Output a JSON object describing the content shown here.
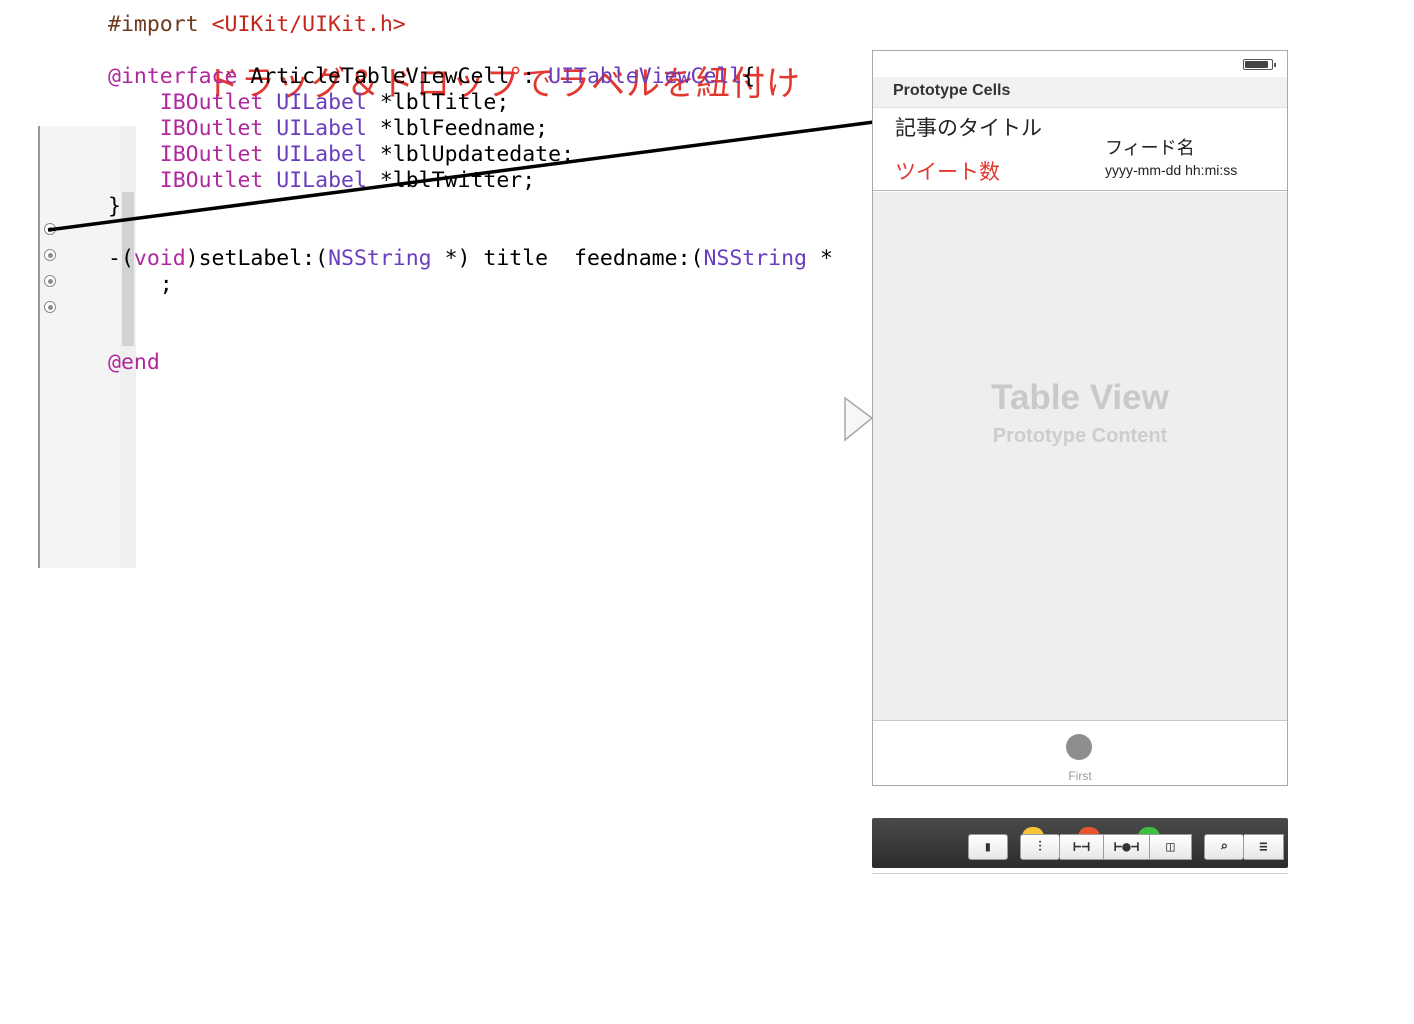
{
  "annotation": {
    "text": "ドラッグ＆ドロップでラベルを紐付け"
  },
  "code": {
    "lines": [
      [
        {
          "t": "#import ",
          "c": "pp"
        },
        {
          "t": "<UIKit/UIKit.h>",
          "c": "str"
        }
      ],
      [],
      [
        {
          "t": "@interface",
          "c": "kw"
        },
        {
          "t": " ArticleTableViewCell : "
        },
        {
          "t": "UITableViewCell",
          "c": "ty"
        },
        {
          "t": "{"
        }
      ],
      [
        {
          "t": "    "
        },
        {
          "t": "IBOutlet",
          "c": "kw"
        },
        {
          "t": " "
        },
        {
          "t": "UILabel",
          "c": "ty"
        },
        {
          "t": " *lblTitle;"
        }
      ],
      [
        {
          "t": "    "
        },
        {
          "t": "IBOutlet",
          "c": "kw"
        },
        {
          "t": " "
        },
        {
          "t": "UILabel",
          "c": "ty"
        },
        {
          "t": " *lblFeedname;"
        }
      ],
      [
        {
          "t": "    "
        },
        {
          "t": "IBOutlet",
          "c": "kw"
        },
        {
          "t": " "
        },
        {
          "t": "UILabel",
          "c": "ty"
        },
        {
          "t": " *lblUpdatedate;"
        }
      ],
      [
        {
          "t": "    "
        },
        {
          "t": "IBOutlet",
          "c": "kw"
        },
        {
          "t": " "
        },
        {
          "t": "UILabel",
          "c": "ty"
        },
        {
          "t": " *lblTwitter;"
        }
      ],
      [
        {
          "t": "}"
        }
      ],
      [],
      [
        {
          "t": "-("
        },
        {
          "t": "void",
          "c": "kw"
        },
        {
          "t": ")setLabel:("
        },
        {
          "t": "NSString",
          "c": "ty"
        },
        {
          "t": " *) title  feedname:("
        },
        {
          "t": "NSString",
          "c": "ty"
        },
        {
          "t": " *"
        }
      ],
      [
        {
          "t": "    ;"
        }
      ],
      [],
      [],
      [
        {
          "t": "@end",
          "c": "kw"
        }
      ]
    ]
  },
  "scene": {
    "prototype_header": "Prototype Cells",
    "cell": {
      "title": "記事のタイトル",
      "feedname": "フィード名",
      "twitter": "ツイート数",
      "updatedate": "yyyy-mm-dd hh:mi:ss"
    },
    "table_view": {
      "title": "Table View",
      "subtitle": "Prototype Content"
    },
    "tab_bar": {
      "item_label": "First"
    }
  },
  "toolbar": {
    "buttons": [
      {
        "name": "inspect-button",
        "glyph": "▮"
      },
      {
        "name": "align-button",
        "glyph": "⫶"
      },
      {
        "name": "pin-button",
        "glyph": "⊢⊣"
      },
      {
        "name": "resolve-button",
        "glyph": "⊢●⊣"
      },
      {
        "name": "resize-button",
        "glyph": "◫"
      },
      {
        "name": "zoom-button",
        "glyph": "⌕"
      },
      {
        "name": "menu-button",
        "glyph": "≡"
      }
    ]
  },
  "colors": {
    "annotation": "#e2382f",
    "keyword": "#b0289c",
    "type": "#6a3dbf",
    "string": "#c4281c",
    "preprocessor": "#6d3b1e"
  }
}
